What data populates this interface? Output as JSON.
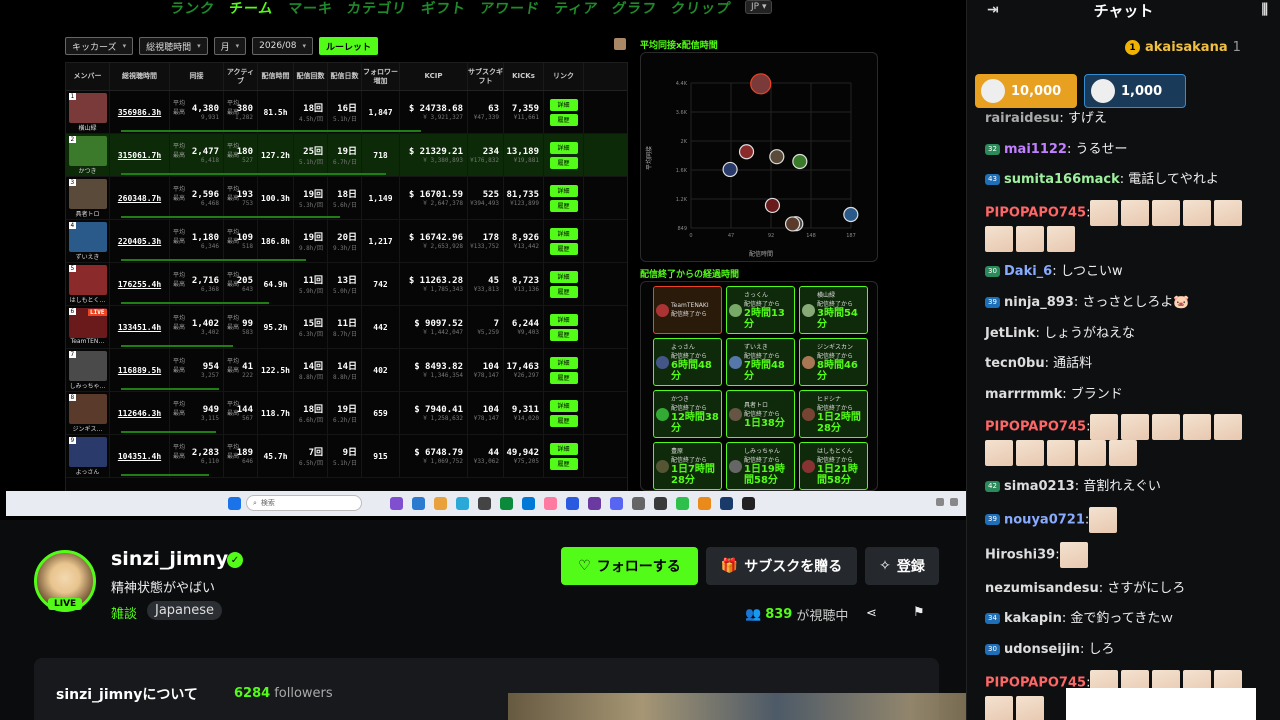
{
  "nav": {
    "items": [
      "ランク",
      "チーム",
      "マーキ",
      "カテゴリ",
      "ギフト",
      "アワード",
      "ティア",
      "グラフ",
      "クリップ"
    ],
    "active": 1,
    "lang": "JP ▾"
  },
  "filters": {
    "team": "キッカーズ",
    "metric": "総視聴時間",
    "period": "月",
    "month": "2026/08",
    "roulette": "ルーレット"
  },
  "table": {
    "headers": [
      "メンバー",
      "総視聴時間",
      "同接",
      "アクティブ",
      "配信時間",
      "配信回数",
      "配信日数",
      "フォロワー増加",
      "KCIP",
      "サブスクギフト",
      "KICKs",
      "リンク"
    ],
    "avg_label": "平均",
    "max_label": "最高",
    "detail": "詳細",
    "history": "履歴",
    "rows": [
      {
        "rank": "1",
        "name": "横山緑",
        "total": "356986.3h",
        "viewers_avg": "4,380",
        "viewers_max": "9,931",
        "active_avg": "380",
        "active_max": "1,282",
        "hours": "81.5h",
        "count": "18回",
        "count_sub": "4.5h/回",
        "days": "16日",
        "days_sub": "5.1h/日",
        "follow": "1,847",
        "kcip": "$ 24738.68",
        "kcip_jpy": "¥ 3,921,327",
        "subs": "63",
        "subs_jpy": "¥47,339",
        "kicks": "7,359",
        "kicks_jpy": "¥11,661",
        "color": "#7a3a3a"
      },
      {
        "rank": "2",
        "name": "かつき",
        "total": "315061.7h",
        "viewers_avg": "2,477",
        "viewers_max": "6,418",
        "active_avg": "180",
        "active_max": "527",
        "hours": "127.2h",
        "count": "25回",
        "count_sub": "5.1h/回",
        "days": "19日",
        "days_sub": "6.7h/日",
        "follow": "718",
        "kcip": "$ 21329.21",
        "kcip_jpy": "¥ 3,380,893",
        "subs": "234",
        "subs_jpy": "¥176,832",
        "kicks": "13,189",
        "kicks_jpy": "¥19,881",
        "color": "#3a7a2a"
      },
      {
        "rank": "3",
        "name": "具者トロ",
        "total": "260348.7h",
        "viewers_avg": "2,596",
        "viewers_max": "6,468",
        "active_avg": "193",
        "active_max": "753",
        "hours": "100.3h",
        "count": "19回",
        "count_sub": "5.3h/回",
        "days": "18日",
        "days_sub": "5.6h/日",
        "follow": "1,149",
        "kcip": "$ 16701.59",
        "kcip_jpy": "¥ 2,647,378",
        "subs": "525",
        "subs_jpy": "¥394,493",
        "kicks": "81,735",
        "kicks_jpy": "¥123,899",
        "color": "#5a4a3a"
      },
      {
        "rank": "4",
        "name": "ずいえき",
        "total": "220405.3h",
        "viewers_avg": "1,180",
        "viewers_max": "6,346",
        "active_avg": "109",
        "active_max": "518",
        "hours": "186.8h",
        "count": "19回",
        "count_sub": "9.8h/回",
        "days": "20日",
        "days_sub": "9.3h/日",
        "follow": "1,217",
        "kcip": "$ 16742.96",
        "kcip_jpy": "¥ 2,653,928",
        "subs": "178",
        "subs_jpy": "¥133,752",
        "kicks": "8,926",
        "kicks_jpy": "¥13,442",
        "color": "#2a5a8a"
      },
      {
        "rank": "5",
        "name": "はしもとく…",
        "total": "176255.4h",
        "viewers_avg": "2,716",
        "viewers_max": "6,368",
        "active_avg": "205",
        "active_max": "643",
        "hours": "64.9h",
        "count": "11回",
        "count_sub": "5.9h/回",
        "days": "13日",
        "days_sub": "5.0h/日",
        "follow": "742",
        "kcip": "$ 11263.28",
        "kcip_jpy": "¥ 1,785,343",
        "subs": "45",
        "subs_jpy": "¥33,813",
        "kicks": "8,723",
        "kicks_jpy": "¥13,136",
        "color": "#8a2a2a"
      },
      {
        "rank": "6",
        "name": "TeamTEN…",
        "total": "133451.4h",
        "viewers_avg": "1,402",
        "viewers_max": "3,402",
        "active_avg": "99",
        "active_max": "583",
        "hours": "95.2h",
        "count": "15回",
        "count_sub": "6.3h/回",
        "days": "11日",
        "days_sub": "8.7h/日",
        "follow": "442",
        "kcip": "$ 9097.52",
        "kcip_jpy": "¥ 1,442,047",
        "subs": "7",
        "subs_jpy": "¥5,259",
        "kicks": "6,244",
        "kicks_jpy": "¥9,403",
        "color": "#6a1a1a",
        "live": "LIVE"
      },
      {
        "rank": "7",
        "name": "しみっちゃ…",
        "total": "116889.5h",
        "viewers_avg": "954",
        "viewers_max": "3,257",
        "active_avg": "41",
        "active_max": "222",
        "hours": "122.5h",
        "count": "14回",
        "count_sub": "8.8h/回",
        "days": "14日",
        "days_sub": "8.8h/日",
        "follow": "402",
        "kcip": "$ 8493.82",
        "kcip_jpy": "¥ 1,346,354",
        "subs": "104",
        "subs_jpy": "¥78,147",
        "kicks": "17,463",
        "kicks_jpy": "¥26,297",
        "color": "#4a4a4a"
      },
      {
        "rank": "8",
        "name": "ジンギス…",
        "total": "112646.3h",
        "viewers_avg": "949",
        "viewers_max": "3,115",
        "active_avg": "144",
        "active_max": "567",
        "hours": "118.7h",
        "count": "18回",
        "count_sub": "6.6h/回",
        "days": "19日",
        "days_sub": "6.2h/日",
        "follow": "659",
        "kcip": "$ 7940.41",
        "kcip_jpy": "¥ 1,258,632",
        "subs": "104",
        "subs_jpy": "¥78,147",
        "kicks": "9,311",
        "kicks_jpy": "¥14,020",
        "color": "#5a3a2a"
      },
      {
        "rank": "9",
        "name": "よっさん",
        "total": "104351.4h",
        "viewers_avg": "2,283",
        "viewers_max": "6,110",
        "active_avg": "189",
        "active_max": "646",
        "hours": "45.7h",
        "count": "7回",
        "count_sub": "6.5h/回",
        "days": "9日",
        "days_sub": "5.1h/日",
        "follow": "915",
        "kcip": "$ 6748.79",
        "kcip_jpy": "¥ 1,069,752",
        "subs": "44",
        "subs_jpy": "¥33,062",
        "kicks": "49,942",
        "kicks_jpy": "¥75,205",
        "color": "#2a3a6a"
      }
    ]
  },
  "scatter": {
    "title": "平均同接x配信時間",
    "xlabel": "配信時間",
    "ylabel": "平均同接",
    "yticks": [
      "4.4K",
      "3.6K",
      "2K",
      "1.6K",
      "1.2K",
      "849"
    ],
    "xticks": [
      "0",
      "47",
      "92",
      "148",
      "187"
    ]
  },
  "elapsed": {
    "title": "配信終了からの経過時間",
    "sub": "配信終了から",
    "cards": [
      {
        "name": "TeamTENAKI",
        "value": "",
        "first": true
      },
      {
        "name": "さっくん",
        "value": "2時間13分"
      },
      {
        "name": "横山緑",
        "value": "3時間54分"
      },
      {
        "name": "よっさん",
        "value": "6時間48分"
      },
      {
        "name": "ずいえき",
        "value": "7時間48分"
      },
      {
        "name": "ジンギスカン",
        "value": "8時間46分"
      },
      {
        "name": "かつき",
        "value": "12時間38分"
      },
      {
        "name": "具者トロ",
        "value": "1日38分"
      },
      {
        "name": "ヒドシナ",
        "value": "1日2時間28分"
      },
      {
        "name": "豊原",
        "value": "1日7時間28分"
      },
      {
        "name": "しみっちゃん",
        "value": "1日19時間58分"
      },
      {
        "name": "はしもとくん",
        "value": "1日21時間58分"
      }
    ]
  },
  "taskbar": {
    "search": "検索"
  },
  "stream": {
    "username": "sinzi_jimny",
    "title": "精神状態がやばい",
    "category": "雑談",
    "tag": "Japanese",
    "live": "LIVE",
    "follow": "フォローする",
    "gift": "サブスクを贈る",
    "register": "登録",
    "viewers": "839",
    "viewers_suffix": "が視聴中",
    "about": "sinzi_jimnyについて",
    "followers": "6284",
    "followers_label": "followers"
  },
  "chat": {
    "title": "チャット",
    "pinned_user": "akaisakana",
    "pinned_count": "1",
    "pinned_rank": "1",
    "kicks": [
      "10,000",
      "1,000"
    ],
    "messages": [
      {
        "badge": "",
        "user": "rairaidesu",
        "text": ": すげえ",
        "color": "#aaa"
      },
      {
        "badge": "32",
        "user": "mai1122",
        "text": ": うるせー",
        "color": "#c080ff"
      },
      {
        "badge": "43",
        "user": "sumita166mack",
        "text": ": 電話してやれよ",
        "color": "#9ef09e"
      },
      {
        "badge": "",
        "user": "PIPOPAPO745",
        "text": ":",
        "color": "#ff6666",
        "emotes": 8
      },
      {
        "badge": "30",
        "user": "Daki_6",
        "text": ": しつこいw",
        "color": "#88aaff"
      },
      {
        "badge": "39",
        "user": "ninja_893",
        "text": ": さっさとしろよ🐷",
        "color": "#ddd"
      },
      {
        "badge": "",
        "user": "JetLink",
        "text": ": しょうがねえな",
        "color": "#ddd"
      },
      {
        "badge": "",
        "user": "tecn0bu",
        "text": ": 通話料",
        "color": "#ddd"
      },
      {
        "badge": "",
        "user": "marrrmmk",
        "text": ": ブランド",
        "color": "#ddd"
      },
      {
        "badge": "",
        "user": "PIPOPAPO745",
        "text": ":",
        "color": "#ff6666",
        "emotes": 10
      },
      {
        "badge": "42",
        "user": "sima0213",
        "text": ": 音割れえぐい",
        "color": "#ddd"
      },
      {
        "badge": "39",
        "user": "nouya0721",
        "text": ":",
        "color": "#88aaff",
        "emotes": 1
      },
      {
        "badge": "",
        "user": "Hiroshi39",
        "text": ":",
        "color": "#ddd",
        "emotes": 1
      },
      {
        "badge": "",
        "user": "nezumisandesu",
        "text": ": さすがにしろ",
        "color": "#ddd"
      },
      {
        "badge": "34",
        "user": "kakapin",
        "text": ": 金で釣ってきたｗ",
        "color": "#ddd"
      },
      {
        "badge": "30",
        "user": "udonseijin",
        "text": ": しろ",
        "color": "#ddd"
      },
      {
        "badge": "",
        "user": "PIPOPAPO745",
        "text": ":",
        "color": "#ff6666",
        "emotes": 7
      }
    ]
  }
}
